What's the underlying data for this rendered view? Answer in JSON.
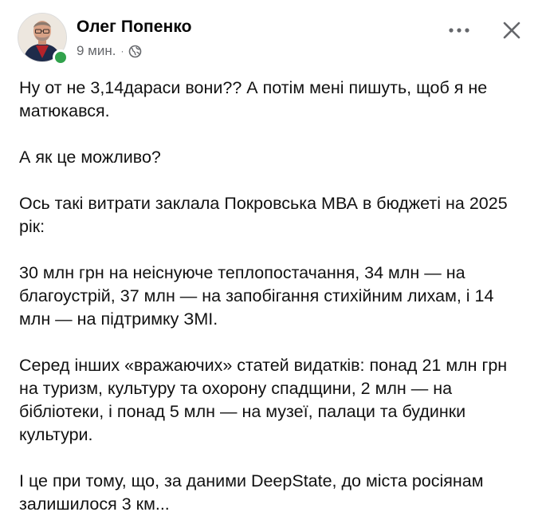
{
  "post": {
    "author": "Олег Попенко",
    "time": "9 мин.",
    "separator": "·",
    "visibility_icon": "globe-icon",
    "actions": {
      "more_icon": "more-horizontal-icon",
      "close_icon": "close-icon"
    },
    "paragraphs": [
      "Ну от не 3,14дараси вони?? А потім мені пишуть, щоб я не матюкався.",
      "А як це можливо?",
      "Ось такі витрати заклала Покровська МВА в бюджеті на 2025 рік:",
      "30 млн грн на неіснуюче теплопостачання, 34 млн — на благоустрій, 37 млн — на запобігання стихійним лихам, і 14 млн — на підтримку ЗМІ.",
      "Серед інших «вражаючих» статей видатків: понад 21 млн грн на туризм, культуру та охорону спадщини, 2 млн — на бібліотеки, і понад 5 млн — на музеї, палаци та будинки культури.",
      " І це при тому, що, за даними DeepState, до міста росіянам залишилося 3 км..."
    ]
  },
  "colors": {
    "online": "#31a24c",
    "meta_text": "#65676b",
    "text": "#050505"
  }
}
